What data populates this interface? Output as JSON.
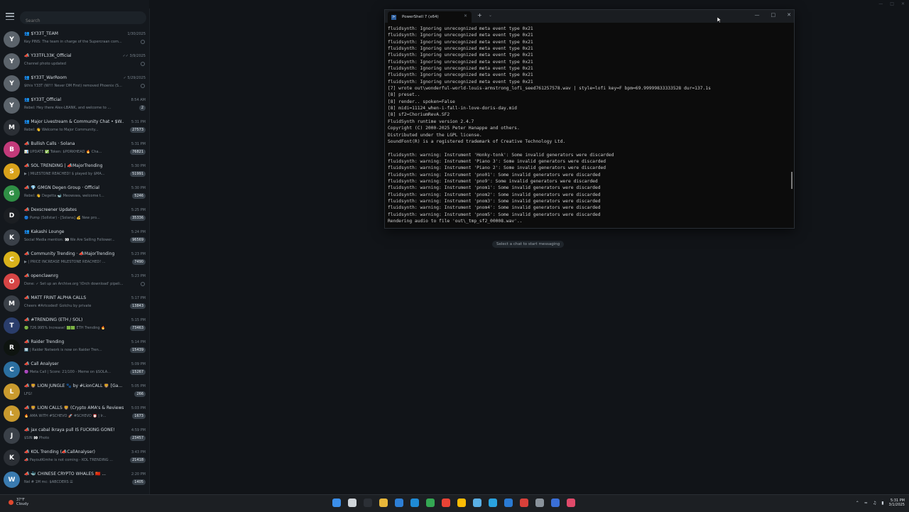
{
  "search": {
    "placeholder": "Search"
  },
  "chats": [
    {
      "title": "👥 $Y33T_TEAM",
      "time": "1/30/2025",
      "preview": "Key PINS: The team in charge of the Supercraan com...",
      "badge": "",
      "avatar_bg": "#5b636b",
      "avatar_text": "Y"
    },
    {
      "title": "📣 Y33TFL33K_Official",
      "time": "✓✓ 3/9/2025",
      "preview": "Channel photo updated",
      "badge": "",
      "avatar_bg": "#5b636b",
      "avatar_text": "Y"
    },
    {
      "title": "👥 $Y33T_WarRoom",
      "time": "✓ 5/29/2025",
      "preview": "$this Y33T (W!!! Never DM First) removed Phoenix (S...",
      "badge": "",
      "avatar_bg": "#5b636b",
      "avatar_text": "Y"
    },
    {
      "title": "👥 $Y33T_Official",
      "time": "8:54 AM",
      "preview": "Rebel: Hey there Alex-LBANK, and welcome to ...",
      "badge": "2",
      "avatar_bg": "#5b636b",
      "avatar_text": "Y"
    },
    {
      "title": "👥 Major Livestream & Community Chat • $W...",
      "time": "5:31 PM",
      "preview": "Rebel: 👋 Welcome to Major Community...",
      "badge": "27573",
      "avatar_bg": "#2b2f35",
      "avatar_text": "M"
    },
    {
      "title": "📣 Bullish Calls · Solana",
      "time": "5:31 PM",
      "preview": "📊 UPDATE ✅ Token: $PORKHEAD 🔥 Cha...",
      "badge": "76821",
      "avatar_bg": "#c23a7a",
      "avatar_text": "B"
    },
    {
      "title": "📣 SOL TRENDING | 📣MajorTrending",
      "time": "5:30 PM",
      "preview": "▶ | MILESTONE REACHED! $ played by $MA...",
      "badge": "51991",
      "avatar_bg": "#d9a21b",
      "avatar_text": "S"
    },
    {
      "title": "📣 💎 GMGN Degen Group · Official",
      "time": "5:30 PM",
      "preview": "Rebel: 👋 Degetta 🐋 Meowswa, welcome t...",
      "badge": "5246",
      "avatar_bg": "#2f8f45",
      "avatar_text": "G"
    },
    {
      "title": "📣 Dexscreener Updates",
      "time": "5:25 PM",
      "preview": "🔵 Pump (Sollstar) - [Solana] 💰 New pro...",
      "badge": "35336",
      "avatar_bg": "#1b1e22",
      "avatar_text": "D"
    },
    {
      "title": "👥 Kakashi Lounge",
      "time": "5:24 PM",
      "preview": "Social Media mention: 👀 We Are Selling Follower...",
      "badge": "96569",
      "avatar_bg": "#3a4048",
      "avatar_text": "K"
    },
    {
      "title": "📣 Community Trending · 📣MajorTrending",
      "time": "5:23 PM",
      "preview": "▶ | PRICE INCREASE MILESTONE REACHED! ...",
      "badge": "7490",
      "avatar_bg": "#d9b21b",
      "avatar_text": "C"
    },
    {
      "title": "📣 openclawnrg",
      "time": "5:23 PM",
      "preview": "Done: ✓ Set up an Archive.org 'iOrch download' pipeli...",
      "badge": "",
      "avatar_bg": "#d64545",
      "avatar_text": "O"
    },
    {
      "title": "📣 MATT FRINT ALPHA CALLS",
      "time": "5:17 PM",
      "preview": "Cheers #Artcoded! Gotchu by private",
      "badge": "13843",
      "avatar_bg": "#3a4048",
      "avatar_text": "M"
    },
    {
      "title": "📣 #TRENDING (ETH / SOL)",
      "time": "5:15 PM",
      "preview": "🟢 726.995% Increase! 🟩🟩 ETH Trending 🔥",
      "badge": "73463",
      "avatar_bg": "#2a3d6b",
      "avatar_text": "T"
    },
    {
      "title": "📣 Raider Trending",
      "time": "5:14 PM",
      "preview": "🔟 | Raider Network is now on Raider Tren...",
      "badge": "15439",
      "avatar_bg": "#0e1410",
      "avatar_text": "R"
    },
    {
      "title": "📣 Call Analyser",
      "time": "5:09 PM",
      "preview": "🟣 Meta Call | Score: 21/100 - Meme on $SOLA...",
      "badge": "15267",
      "avatar_bg": "#2b6fa0",
      "avatar_text": "C"
    },
    {
      "title": "📣 🦁 LION JUNGLE 🐾 by #LionCALL 🦁 [Ga...",
      "time": "5:05 PM",
      "preview": "LFG!",
      "badge": "266",
      "avatar_bg": "#c99a2e",
      "avatar_text": "L"
    },
    {
      "title": "📣 🦁 LION CALLS 🦁 (Crypto AMA's & Reviews)",
      "time": "5:03 PM",
      "preview": "🔥 AMA WITH #SCHEVO 🚀 #SCHEVO ⏰ | Ir...",
      "badge": "1673",
      "avatar_bg": "#c99a2e",
      "avatar_text": "L"
    },
    {
      "title": "📣 jax cabal ikraya pull IS FUCKING GONE!",
      "time": "4:59 PM",
      "preview": "$SIN 👀 Photo",
      "badge": "23457",
      "avatar_bg": "#3a4048",
      "avatar_text": "J"
    },
    {
      "title": "📣 KOL Trending (📣CallAnalyser)",
      "time": "3:43 PM",
      "preview": "📣 PayoutKimhe is not coming - KOL TRENDING ...",
      "badge": "21418",
      "avatar_bg": "#2b2f35",
      "avatar_text": "K"
    },
    {
      "title": "📣 🐳 CHINESE CRYPTO WHALES 🇨🇳 ...",
      "time": "2:20 PM",
      "preview": "Nel # 1M mc: $ABCDERS ☰",
      "badge": "1405",
      "avatar_bg": "#3a7bb0",
      "avatar_text": "W"
    }
  ],
  "empty_state": "Select a chat to start messaging",
  "terminal": {
    "tab_label": "PowerShell 7 (x64)",
    "lines": [
      "fluidsynth: Ignoring unrecognized meta event type 0x21",
      "fluidsynth: Ignoring unrecognized meta event type 0x21",
      "fluidsynth: Ignoring unrecognized meta event type 0x21",
      "fluidsynth: Ignoring unrecognized meta event type 0x21",
      "fluidsynth: Ignoring unrecognized meta event type 0x21",
      "fluidsynth: Ignoring unrecognized meta event type 0x21",
      "fluidsynth: Ignoring unrecognized meta event type 0x21",
      "fluidsynth: Ignoring unrecognized meta event type 0x21",
      "fluidsynth: Ignoring unrecognized meta event type 0x21",
      "[7] wrote out\\wonderful-world-louis-armstrong_lofi_seed761257578.wav | style=lofi key=F bpm=69.99999833333528 dur=137.1s",
      "[8] preset..",
      "[8] render.. spoken=False",
      "[8] midi=11124_when-i-fall-in-love-doris-day.mid",
      "[8] sf2=ChoriumRevA.SF2",
      "FluidSynth runtime version 2.4.7",
      "Copyright (C) 2000-2025 Peter Hanappe and others.",
      "Distributed under the LGPL license.",
      "SoundFont(R) is a registered trademark of Creative Technology Ltd.",
      "",
      "fluidsynth: warning: Instrument 'Honky-tonk': Some invalid generators were discarded",
      "fluidsynth: warning: Instrument 'Piano 3': Some invalid generators were discarded",
      "fluidsynth: warning: Instrument 'Piano 2': Some invalid generators were discarded",
      "fluidsynth: warning: Instrument 'pno01': Some invalid generators were discarded",
      "fluidsynth: warning: Instrument 'pno9': Some invalid generators were discarded",
      "fluidsynth: warning: Instrument 'pnom1': Some invalid generators were discarded",
      "fluidsynth: warning: Instrument 'pnom2': Some invalid generators were discarded",
      "fluidsynth: warning: Instrument 'pnom3': Some invalid generators were discarded",
      "fluidsynth: warning: Instrument 'pnom4': Some invalid generators were discarded",
      "fluidsynth: warning: Instrument 'pnom5': Some invalid generators were discarded",
      "Rendering audio to file 'out\\_tmp_sf2_00008.wav'.."
    ]
  },
  "taskbar": {
    "weather_line1": "37°F",
    "weather_line2": "Cloudy",
    "clock_time": "5:31 PM",
    "clock_date": "3/1/2025",
    "icons": [
      {
        "name": "start-icon",
        "color": "#3b8eea"
      },
      {
        "name": "task-view-icon",
        "color": "#d0d5da"
      },
      {
        "name": "terminal-app-icon",
        "color": "#2b2f35"
      },
      {
        "name": "file-explorer-icon",
        "color": "#e8b73a"
      },
      {
        "name": "store-icon",
        "color": "#2d7fd6"
      },
      {
        "name": "edge-icon",
        "color": "#1f8bd6"
      },
      {
        "name": "chrome-icon",
        "color": "#34a853"
      },
      {
        "name": "chrome-profile-icon",
        "color": "#ea4335"
      },
      {
        "name": "chrome-profile-2-icon",
        "color": "#fbbc05"
      },
      {
        "name": "notepad-icon",
        "color": "#5ab0e6"
      },
      {
        "name": "telegram-icon",
        "color": "#2aa3e0"
      },
      {
        "name": "vscode-icon",
        "color": "#2a7bd4"
      },
      {
        "name": "app-red-icon",
        "color": "#d8403a"
      },
      {
        "name": "settings-icon",
        "color": "#8a939c"
      },
      {
        "name": "app-blue-icon",
        "color": "#3a6fd8"
      },
      {
        "name": "app-pink-icon",
        "color": "#e04a6a"
      }
    ]
  }
}
